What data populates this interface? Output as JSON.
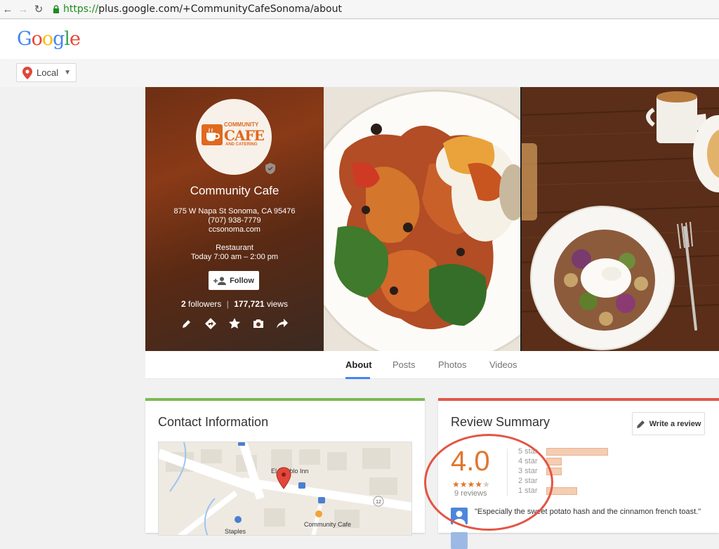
{
  "browser": {
    "url_scheme": "https://",
    "url_rest": "plus.google.com/+CommunityCafeSonoma/about"
  },
  "header": {
    "logo_letters": [
      {
        "ch": "G",
        "color": "#4285f4"
      },
      {
        "ch": "o",
        "color": "#ea4335"
      },
      {
        "ch": "o",
        "color": "#fbbc05"
      },
      {
        "ch": "g",
        "color": "#4285f4"
      },
      {
        "ch": "l",
        "color": "#34a853"
      },
      {
        "ch": "e",
        "color": "#ea4335"
      }
    ],
    "local_label": "Local"
  },
  "profile": {
    "logo_top": "COMMUNITY",
    "logo_main": "CAFE",
    "logo_bottom": "AND CATERING",
    "name": "Community Cafe",
    "address": "875 W Napa St Sonoma, CA 95476",
    "phone": "(707) 938-7779",
    "website": "ccsonoma.com",
    "category": "Restaurant",
    "hours": "Today 7:00 am – 2:00 pm",
    "follow_label": "Follow",
    "followers_count": "2",
    "followers_label": "followers",
    "separator": "|",
    "views_count": "177,721",
    "views_label": "views"
  },
  "tabs": [
    {
      "label": "About",
      "active": true
    },
    {
      "label": "Posts",
      "active": false
    },
    {
      "label": "Photos",
      "active": false
    },
    {
      "label": "Videos",
      "active": false
    }
  ],
  "contact": {
    "title": "Contact Information",
    "map_labels": {
      "inn": "El Pueblo Inn",
      "cafe": "Community Cafe",
      "store": "Staples",
      "route": "12"
    }
  },
  "review_summary": {
    "title": "Review Summary",
    "write_label": "Write a review",
    "rating": "4.0",
    "stars_filled": 4,
    "stars_total": 5,
    "reviews_text": "9 reviews",
    "distribution": [
      {
        "label": "5 star",
        "count": 4
      },
      {
        "label": "4 star",
        "count": 1
      },
      {
        "label": "3 star",
        "count": 1
      },
      {
        "label": "2 star",
        "count": 0
      },
      {
        "label": "1 star",
        "count": 2
      }
    ],
    "quotes": [
      "\"Especially the sweet potato hash and the cinnamon french toast.\""
    ]
  },
  "colors": {
    "accent_contact": "#7cb951",
    "accent_review": "#e0594a",
    "rating_orange": "#e0762f",
    "highlight_circle": "#e35545"
  }
}
